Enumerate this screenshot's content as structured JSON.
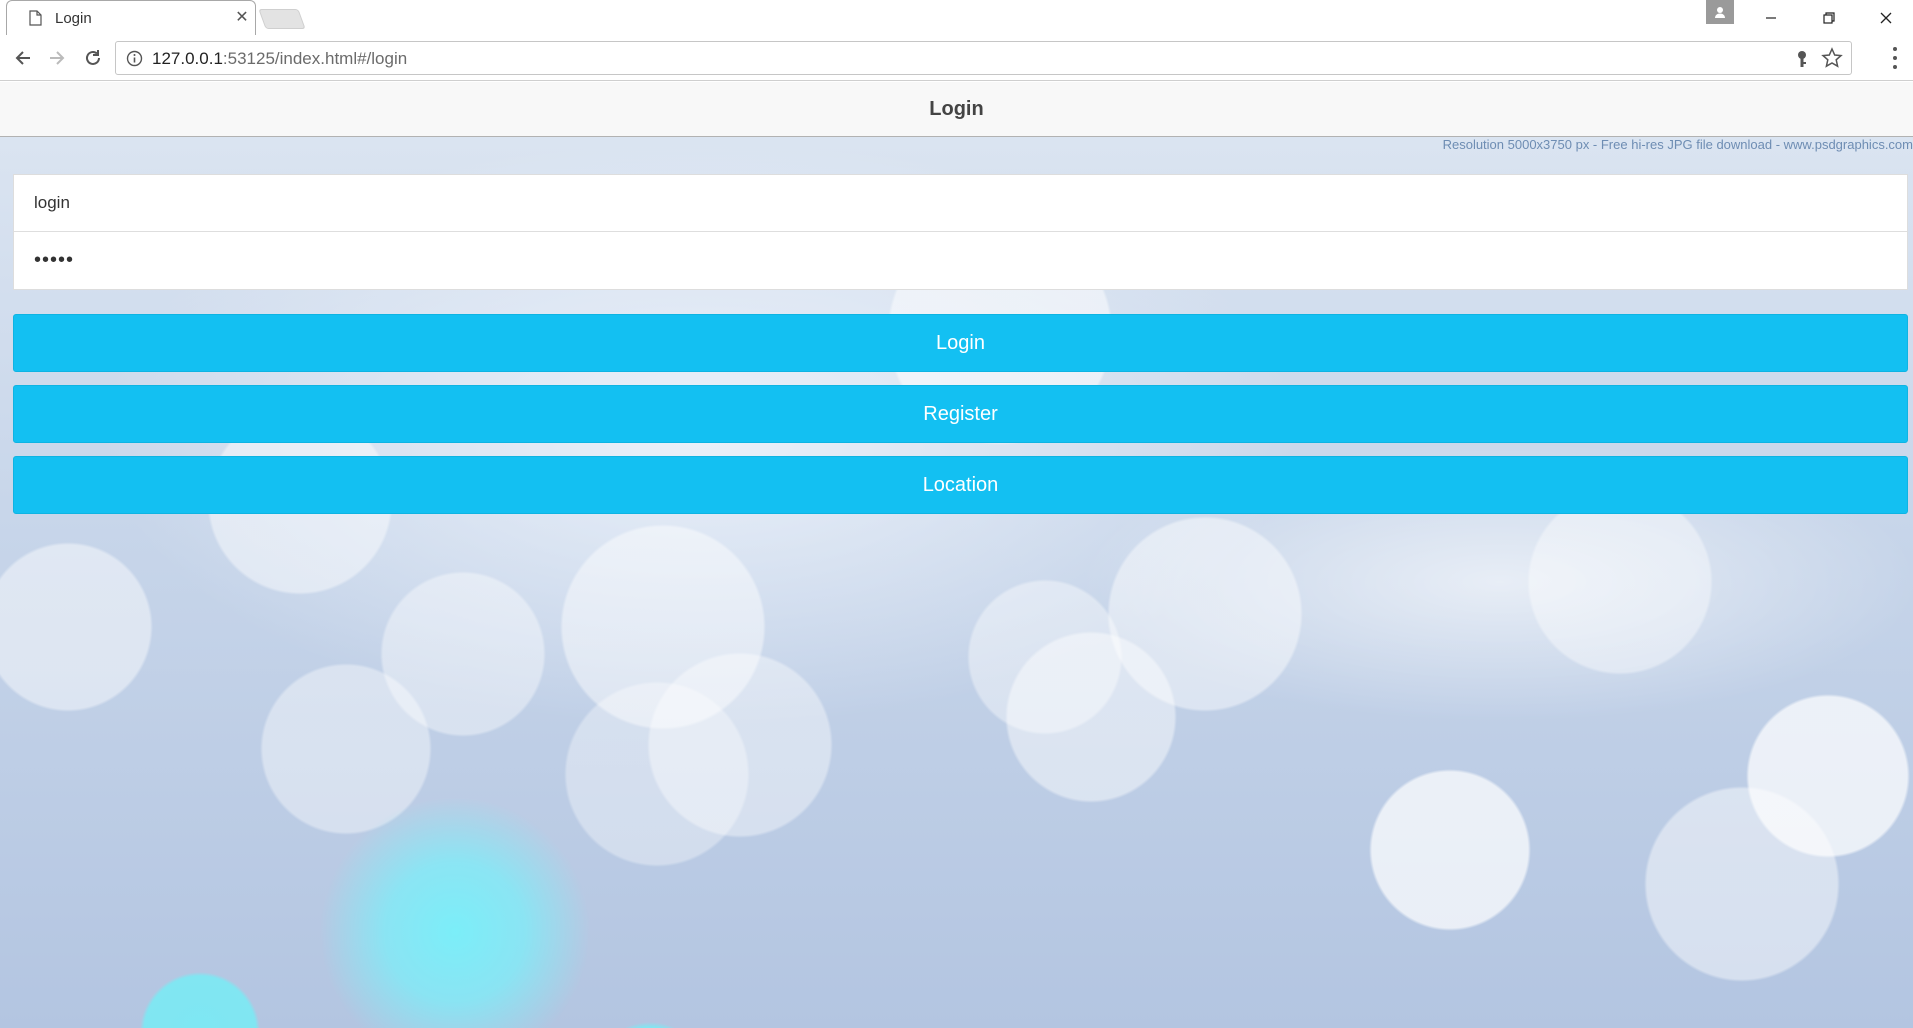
{
  "browser": {
    "tab_title": "Login",
    "tab_close": "✕",
    "url_host": "127.0.0.1",
    "url_rest": ":53125/index.html#/login",
    "icons": [
      "page-icon",
      "close-icon",
      "back-icon",
      "forward-icon",
      "reload-icon",
      "info-icon",
      "key-icon",
      "star-icon",
      "menu-icon",
      "profile-icon",
      "minimize-icon",
      "restore-icon",
      "close-window-icon"
    ]
  },
  "app": {
    "header_title": "Login",
    "watermark": "Resolution 5000x3750 px   -   Free hi-res JPG file download   -   www.psdgraphics.com",
    "form": {
      "login_value": "login",
      "password_value": "•••••"
    },
    "buttons": {
      "login": "Login",
      "register": "Register",
      "location": "Location"
    },
    "colors": {
      "button_bg": "#13c0f2",
      "button_text": "#ffffff",
      "header_bg": "#f8f8f8"
    }
  }
}
